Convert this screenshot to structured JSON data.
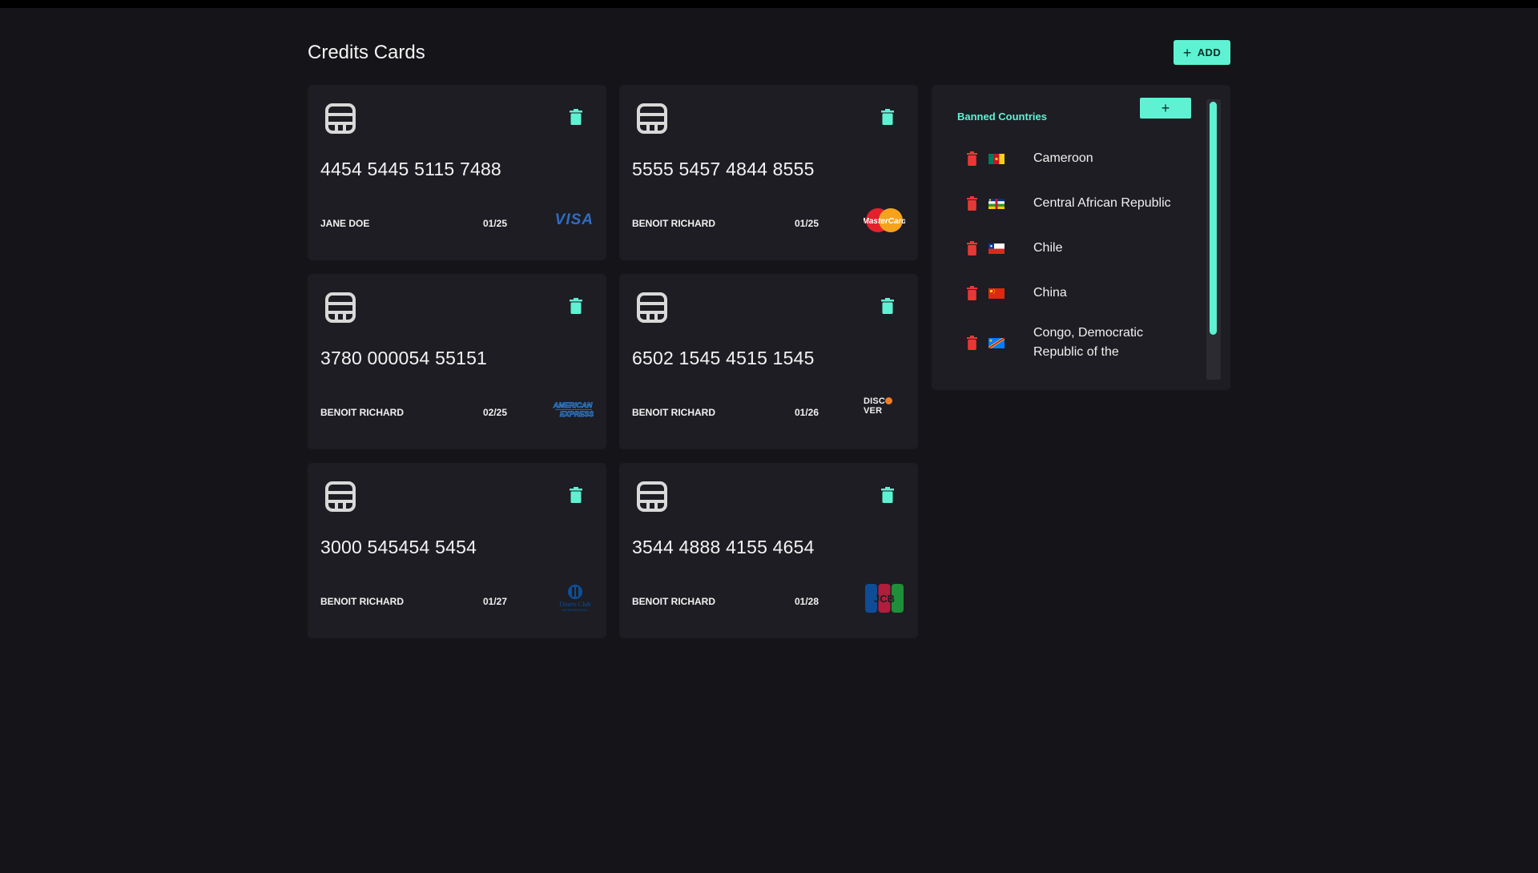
{
  "header": {
    "title": "Credits Cards",
    "add_label": "ADD"
  },
  "cards": [
    {
      "number": "4454 5445 5115 7488",
      "holder": "JANE DOE",
      "expiry": "01/25",
      "brand": "visa-logo"
    },
    {
      "number": "5555 5457 4844 8555",
      "holder": "BENOIT RICHARD",
      "expiry": "01/25",
      "brand": "mastercard-logo"
    },
    {
      "number": "3780 000054 55151",
      "holder": "BENOIT RICHARD",
      "expiry": "02/25",
      "brand": "american-express-logo"
    },
    {
      "number": "6502 1545 4515 1545",
      "holder": "BENOIT RICHARD",
      "expiry": "01/26",
      "brand": "discover-logo"
    },
    {
      "number": "3000 545454 5454",
      "holder": "BENOIT RICHARD",
      "expiry": "01/27",
      "brand": "diners-club-logo"
    },
    {
      "number": "3544 4888 4155 4654",
      "holder": "BENOIT RICHARD",
      "expiry": "01/28",
      "brand": "jcb-logo"
    }
  ],
  "banned_countries": {
    "title": "Banned Countries",
    "add_label": "+",
    "items": [
      {
        "name": "Cameroon"
      },
      {
        "name": "Central African Republic"
      },
      {
        "name": "Chile"
      },
      {
        "name": "China"
      },
      {
        "name": "Congo, Democratic Republic of the"
      }
    ]
  },
  "colors": {
    "accent": "#5ef2d2",
    "danger": "#e53935",
    "background": "#151519",
    "card": "#1d1d23"
  },
  "icons": {
    "card_chip": "chip-icon",
    "delete": "trash-icon"
  }
}
